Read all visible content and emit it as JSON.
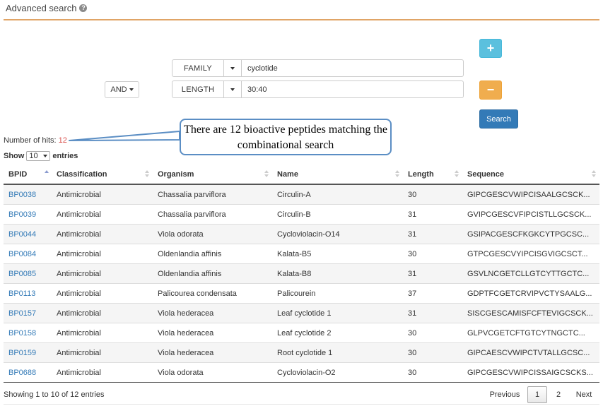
{
  "header": {
    "title": "Advanced search",
    "help_icon": "question-circle-icon"
  },
  "search": {
    "operator": "AND",
    "rows": [
      {
        "field": "FAMILY",
        "value": "cyclotide"
      },
      {
        "field": "LENGTH",
        "value": "30:40"
      }
    ],
    "add_label": "+",
    "remove_label": "−",
    "search_label": "Search"
  },
  "results": {
    "hits_label": "Number of hits:",
    "hits_count": "12",
    "callout": "There are 12 bioactive peptides matching the combinational search",
    "show_label": "Show",
    "page_size": "10",
    "entries_label": "entries",
    "columns": [
      "BPID",
      "Classification",
      "Organism",
      "Name",
      "Length",
      "Sequence"
    ],
    "rows": [
      [
        "BP0038",
        "Antimicrobial",
        "Chassalia parviflora",
        "Circulin-A",
        "30",
        "GIPCGESCVWIPCISAALGCSCK..."
      ],
      [
        "BP0039",
        "Antimicrobial",
        "Chassalia parviflora",
        "Circulin-B",
        "31",
        "GVIPCGESCVFIPCISTLLGCSCK..."
      ],
      [
        "BP0044",
        "Antimicrobial",
        "Viola odorata",
        "Cycloviolacin-O14",
        "31",
        "GSIPACGESCFKGKCYTPGCSC..."
      ],
      [
        "BP0084",
        "Antimicrobial",
        "Oldenlandia affinis",
        "Kalata-B5",
        "30",
        "GTPCGESCVYIPCISGVIGCSCT..."
      ],
      [
        "BP0085",
        "Antimicrobial",
        "Oldenlandia affinis",
        "Kalata-B8",
        "31",
        "GSVLNCGETCLLGTCYTTGCTC..."
      ],
      [
        "BP0113",
        "Antimicrobial",
        "Palicourea condensata",
        "Palicourein",
        "37",
        "GDPTFCGETCRVIPVCTYSAALG..."
      ],
      [
        "BP0157",
        "Antimicrobial",
        "Viola hederacea",
        "Leaf cyclotide 1",
        "31",
        "SISCGESCAMISFCFTEVIGCSCK..."
      ],
      [
        "BP0158",
        "Antimicrobial",
        "Viola hederacea",
        "Leaf cyclotide 2",
        "30",
        "GLPVCGETCFTGTCYTNGCTC..."
      ],
      [
        "BP0159",
        "Antimicrobial",
        "Viola hederacea",
        "Root cyclotide 1",
        "30",
        "GIPCAESCVWIPCTVTALLGCSC..."
      ],
      [
        "BP0688",
        "Antimicrobial",
        "Viola odorata",
        "Cycloviolacin-O2",
        "30",
        "GIPCGESCVWIPCISSAIGCSCKS..."
      ]
    ]
  },
  "footer": {
    "info": "Showing 1 to 10 of 12 entries",
    "previous": "Previous",
    "pages": [
      "1",
      "2"
    ],
    "next": "Next"
  },
  "colors": {
    "accent_rule": "#e0a466",
    "link": "#337ab7",
    "hits_count": "#d9534f",
    "add": "#5bc0de",
    "remove": "#f0ad4e",
    "search": "#337ab7"
  }
}
